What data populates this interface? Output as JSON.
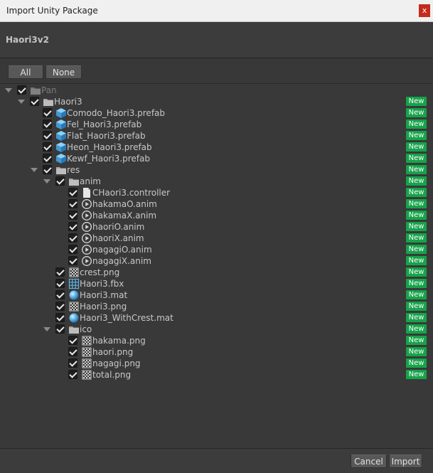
{
  "window": {
    "title": "Import Unity Package",
    "close_glyph": "x"
  },
  "package": {
    "name": "Haori3v2"
  },
  "buttons": {
    "all": "All",
    "none": "None",
    "cancel": "Cancel",
    "import": "Import"
  },
  "badge_label": "New",
  "tree": [
    {
      "label": "Pan",
      "icon": "folder",
      "depth": 0,
      "expanded": true,
      "badge": false,
      "dim": true
    },
    {
      "label": "Haori3",
      "icon": "folder",
      "depth": 1,
      "expanded": true,
      "badge": true
    },
    {
      "label": "Comodo_Haori3.prefab",
      "icon": "prefab",
      "depth": 2,
      "badge": true
    },
    {
      "label": "Fel_Haori3.prefab",
      "icon": "prefab",
      "depth": 2,
      "badge": true
    },
    {
      "label": "Flat_Haori3.prefab",
      "icon": "prefab",
      "depth": 2,
      "badge": true
    },
    {
      "label": "Heon_Haori3.prefab",
      "icon": "prefab",
      "depth": 2,
      "badge": true
    },
    {
      "label": "Kewf_Haori3.prefab",
      "icon": "prefab",
      "depth": 2,
      "badge": true
    },
    {
      "label": "res",
      "icon": "folder",
      "depth": 2,
      "expanded": true,
      "badge": true
    },
    {
      "label": "anim",
      "icon": "folder",
      "depth": 3,
      "expanded": true,
      "badge": true
    },
    {
      "label": "CHaori3.controller",
      "icon": "document",
      "depth": 4,
      "badge": true
    },
    {
      "label": "hakamaO.anim",
      "icon": "anim",
      "depth": 4,
      "badge": true
    },
    {
      "label": "hakamaX.anim",
      "icon": "anim",
      "depth": 4,
      "badge": true
    },
    {
      "label": "haoriO.anim",
      "icon": "anim",
      "depth": 4,
      "badge": true
    },
    {
      "label": "haoriX.anim",
      "icon": "anim",
      "depth": 4,
      "badge": true
    },
    {
      "label": "nagagiO.anim",
      "icon": "anim",
      "depth": 4,
      "badge": true
    },
    {
      "label": "nagagiX.anim",
      "icon": "anim",
      "depth": 4,
      "badge": true
    },
    {
      "label": "crest.png",
      "icon": "texture",
      "depth": 3,
      "badge": true
    },
    {
      "label": "Haori3.fbx",
      "icon": "mesh",
      "depth": 3,
      "badge": true
    },
    {
      "label": "Haori3.mat",
      "icon": "material",
      "depth": 3,
      "badge": true
    },
    {
      "label": "Haori3.png",
      "icon": "texture",
      "depth": 3,
      "badge": true
    },
    {
      "label": "Haori3_WithCrest.mat",
      "icon": "material",
      "depth": 3,
      "badge": true
    },
    {
      "label": "ico",
      "icon": "folder",
      "depth": 3,
      "expanded": true,
      "badge": true
    },
    {
      "label": "hakama.png",
      "icon": "texture",
      "depth": 4,
      "badge": true
    },
    {
      "label": "haori.png",
      "icon": "texture",
      "depth": 4,
      "badge": true
    },
    {
      "label": "nagagi.png",
      "icon": "texture",
      "depth": 4,
      "badge": true
    },
    {
      "label": "total.png",
      "icon": "texture",
      "depth": 4,
      "badge": true
    }
  ],
  "colors": {
    "badge": "#16a34a",
    "window_bg": "#383838",
    "icon_blue": "#4fa3d9"
  }
}
